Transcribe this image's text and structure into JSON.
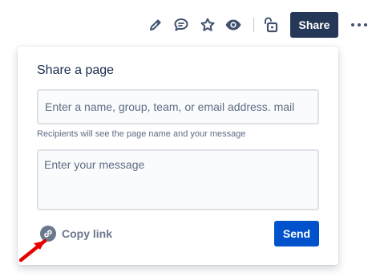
{
  "toolbar": {
    "icons": [
      "pencil-icon",
      "comment-icon",
      "star-icon",
      "eye-icon",
      "unlock-icon"
    ],
    "share_label": "Share",
    "more_icon": "more-icon"
  },
  "dialog": {
    "title": "Share a page",
    "recipients_placeholder": "Enter a name, group, team, or email address. mail",
    "hint": "Recipients will see the page name and your message",
    "message_placeholder": "Enter your message",
    "copy_link_label": "Copy link",
    "copy_link_icon": "link-icon",
    "send_label": "Send"
  },
  "annotation": {
    "pointer": "red-arrow-icon",
    "color": "#E60000"
  },
  "colors": {
    "share_button": "#253858",
    "send_button": "#0052CC",
    "icon": "#42526E"
  }
}
